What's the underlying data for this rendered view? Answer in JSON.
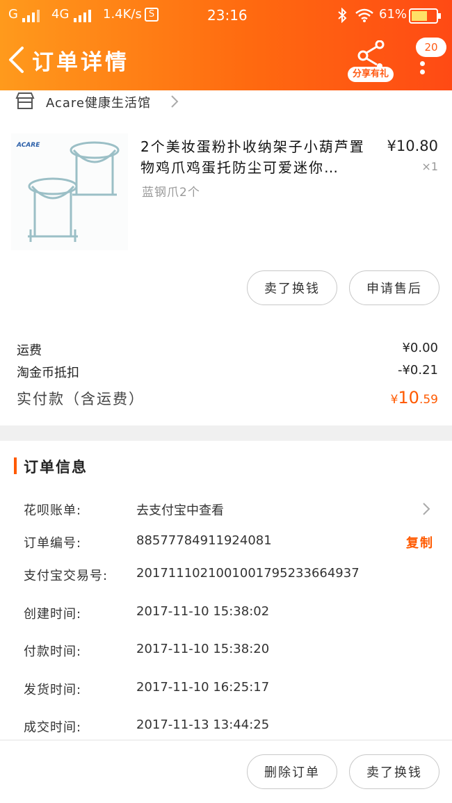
{
  "status_bar": {
    "carrier1": "G",
    "carrier2": "4G",
    "speed": "1.4K/s",
    "s_icon": "S",
    "time": "23:16",
    "battery_pct": "61%"
  },
  "nav": {
    "title": "订单详情",
    "share_label": "分享有礼",
    "badge_count": "20"
  },
  "store": {
    "name": "Acare健康生活馆"
  },
  "product": {
    "title": "2个美妆蛋粉扑收纳架子小葫芦置物鸡爪鸡蛋托防尘可爱迷你…",
    "spec": "蓝钢爪2个",
    "price": "¥10.80",
    "qty": "×1",
    "thumb_logo": "ACARE"
  },
  "product_actions": {
    "sell_label": "卖了换钱",
    "after_sale_label": "申请售后"
  },
  "fees": {
    "shipping_label": "运费",
    "shipping_value": "¥0.00",
    "coin_label": "淘金币抵扣",
    "coin_value": "-¥0.21",
    "paid_label": "实付款（含运费）",
    "paid_symbol": "¥",
    "paid_int": "10",
    "paid_dec": ".59"
  },
  "order_info": {
    "section_title": "订单信息",
    "rows": [
      {
        "label": "花呗账单:",
        "value": "去支付宝中查看"
      },
      {
        "label": "订单编号:",
        "value": "88577784911924081"
      },
      {
        "label": "支付宝交易号:",
        "value": "2017111021001001795233664937"
      },
      {
        "label": "创建时间:",
        "value": "2017-11-10 15:38:02"
      },
      {
        "label": "付款时间:",
        "value": "2017-11-10 15:38:20"
      },
      {
        "label": "发货时间:",
        "value": "2017-11-10 16:25:17"
      },
      {
        "label": "成交时间:",
        "value": "2017-11-13 13:44:25"
      }
    ],
    "copy_label": "复制"
  },
  "bottom_actions": {
    "delete_label": "删除订单",
    "sell_label": "卖了换钱"
  },
  "colors": {
    "accent": "#ff5a00",
    "header_start": "#ff9a1c",
    "header_end": "#ff4a14"
  }
}
